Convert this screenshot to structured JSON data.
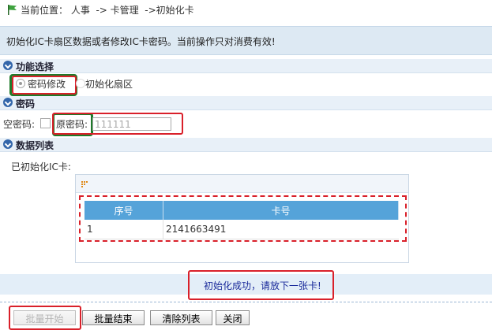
{
  "breadcrumb": {
    "text": "当前位置： 人事  -> 卡管理  ->初始化卡"
  },
  "info": {
    "message": "初始化IC卡扇区数据或者修改IC卡密码。当前操作只对消费有效!"
  },
  "function_section": {
    "title": "功能选择",
    "options": [
      {
        "label": "密码修改",
        "selected": true
      },
      {
        "label": "初始化扇区",
        "selected": false
      }
    ]
  },
  "password_section": {
    "title": "密码",
    "empty_password_label": "空密码:",
    "old_password_label": "原密码:",
    "old_password_value": "111111"
  },
  "data_section": {
    "title": "数据列表",
    "initialized_label": "已初始化IC卡:",
    "table": {
      "columns": [
        "序号",
        "卡号"
      ],
      "rows": [
        [
          "1",
          "2141663491"
        ]
      ]
    }
  },
  "status": {
    "message": "初始化成功，请放下一张卡!"
  },
  "buttons": {
    "batch_start": "批量开始",
    "batch_end": "批量结束",
    "clear_list": "清除列表",
    "close": "关闭"
  },
  "colors": {
    "accent": "#55a3d9",
    "highlight_red": "#d9202a",
    "highlight_green": "#1f7a2a",
    "status_text": "#1a2a9a"
  }
}
